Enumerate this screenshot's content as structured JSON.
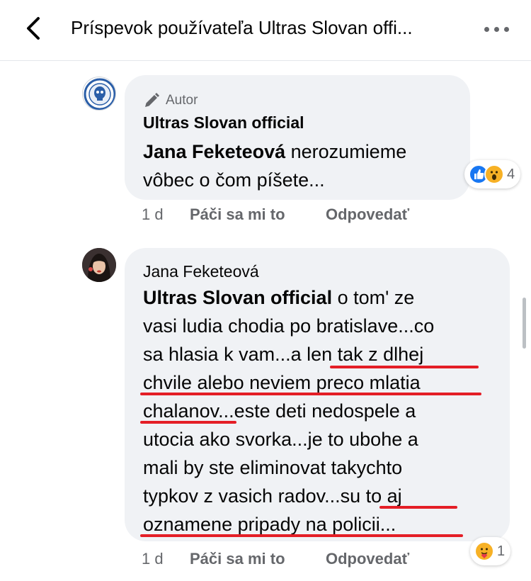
{
  "header": {
    "back_label": "back",
    "title": "Príspevok používateľa Ultras Slovan offi..."
  },
  "comments": [
    {
      "author_badge": "Autor",
      "author": "Ultras Slovan official",
      "mention": "Jana Feketeová",
      "text_lines": [
        "nerozumieme",
        "vôbec o čom píšete..."
      ],
      "time": "1 d",
      "like_label": "Páči sa mi to",
      "reply_label": "Odpovedať",
      "reactions": {
        "icons": [
          "like-icon",
          "wow-icon"
        ],
        "count": "4"
      }
    },
    {
      "author": "Jana Feketeová",
      "mention": "Ultras Slovan official",
      "text_lines": [
        "o tom' ze",
        "vasi ludia chodia po bratislave...co",
        "sa hlasia k vam...a len tak z dlhej",
        "chvile alebo neviem preco mlatia",
        "chalanov...este deti nedospele a",
        "utocia ako svorka...je to ubohe a",
        "mali by ste eliminovat takychto",
        "typkov z vasich radov...su to aj",
        "oznamene pripady na policii..."
      ],
      "time": "1 d",
      "like_label": "Páči sa mi to",
      "reply_label": "Odpovedať",
      "reactions": {
        "icons": [
          "care-icon"
        ],
        "count": "1"
      }
    }
  ],
  "colors": {
    "bubble": "#f0f2f5",
    "secondary_text": "#65676b",
    "annotation_red": "#e41e26",
    "like_blue": "#1877f2",
    "reaction_yellow": "#f7b125"
  }
}
